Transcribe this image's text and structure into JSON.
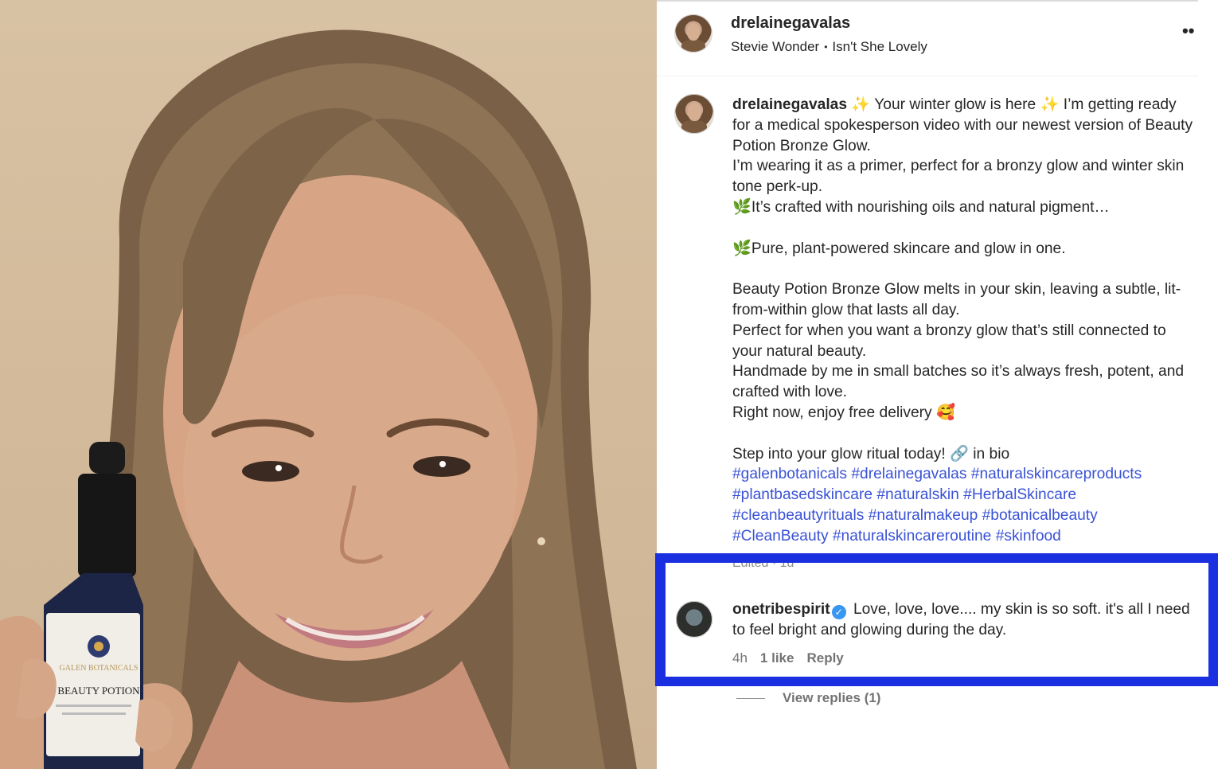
{
  "post": {
    "username": "drelainegavalas",
    "audio_artist": "Stevie Wonder",
    "audio_separator": "•",
    "audio_track": "Isn't She Lovely",
    "more_icon_glyph": "••"
  },
  "caption": {
    "username": "drelainegavalas",
    "sparkle_icon": "✨",
    "headline": " Your winter glow is here ",
    "line1_rest": " I’m getting ready for a medical spokesperson video with our newest version of Beauty Potion Bronze Glow.",
    "line2": "I’m wearing it as a primer, perfect for a bronzy glow and winter skin tone perk-up.",
    "leaf_icon": "🌿",
    "line3": "It’s crafted with nourishing oils and natural pigment…",
    "line4": "Pure, plant-powered skincare and glow in one.",
    "line5": "Beauty Potion Bronze Glow melts in your skin, leaving a subtle, lit-from-within glow that lasts all day.",
    "line6": "Perfect for when you want a bronzy glow that’s still connected to your natural beauty.",
    "line7": "Handmade by me in small batches so it’s always fresh, potent, and crafted with love.",
    "line8": "Right now, enjoy free delivery ",
    "smile_icon": "🥰",
    "line9": "Step into your glow ritual today! ",
    "link_icon": "🔗",
    "line9_end": " in bio",
    "hashtags": [
      "#galenbotanicals",
      "#drelainegavalas",
      "#naturalskincareproducts",
      "#plantbasedskincare",
      "#naturalskin",
      "#HerbalSkincare",
      "#cleanbeautyrituals",
      "#naturalmakeup",
      "#botanicalbeauty",
      "#CleanBeauty",
      "#naturalskincareroutine",
      "#skinfood"
    ],
    "edited": "Edited · 1d"
  },
  "comment": {
    "username": "onetribespirit",
    "verified_glyph": "✓",
    "text": "Love, love, love.... my skin is so soft. it's all I need to feel bright and glowing during the day.",
    "time": "4h",
    "likes": "1 like",
    "reply": "Reply",
    "view_replies": "View replies (1)"
  },
  "bottle": {
    "brand": "GALEN BOTANICALS",
    "product": "BEAUTY POTION"
  },
  "colors": {
    "highlight": "#1a2fe0",
    "hashtag": "#3a52d6",
    "verified": "#3897f0"
  }
}
